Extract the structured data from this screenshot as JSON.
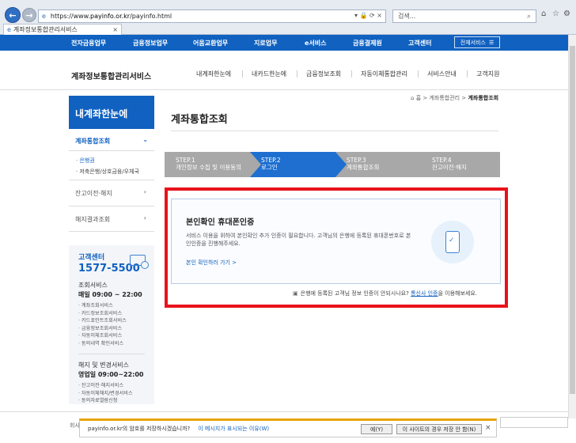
{
  "browser": {
    "url_secure": "https://www.",
    "url_domain": "payinfo.or.kr",
    "url_path": "/payinfo.html",
    "search_placeholder": "검색...",
    "tab_title": "계좌정보통합관리서비스",
    "tab_close": "×"
  },
  "gnb": {
    "items": [
      "전자금융업무",
      "금융정보업무",
      "어음교환업무",
      "지로업무",
      "e서비스",
      "금융결제원",
      "고객센터"
    ],
    "all_services": "전체서비스"
  },
  "header": {
    "logo": "계좌정보통합관리서비스",
    "nav": [
      "내계좌한눈에",
      "내카드한눈에",
      "금융정보조회",
      "자동이체통합관리",
      "서비스안내",
      "고객지원"
    ]
  },
  "breadcrumb": {
    "home": "홈",
    "mid": "계좌통합관리",
    "current": "계좌통합조회"
  },
  "sidebar": {
    "title": "내계좌한눈에",
    "active": "계좌통합조회",
    "sub1": "· 은행권",
    "sub2": "· 저축은행/상호금융/우체국",
    "menu1": "잔고이전·해지",
    "menu2": "해지결과조회"
  },
  "contact": {
    "title": "고객센터",
    "number": "1577-5500",
    "lookup_label": "조회서비스",
    "lookup_hours": "매일 09:00 ~ 22:00",
    "lookup_items": [
      "· 계좌조회서비스",
      "· 카드정보조회서비스",
      "· 카드포인트조회서비스",
      "· 금융정보조회서비스",
      "· 자동이체조회서비스",
      "· 동의내역 확인서비스"
    ],
    "change_label": "해지 및 변경서비스",
    "change_hours": "영업일 09:00~22:00",
    "change_items": [
      "· 잔고이전·해지서비스",
      "· 자동이체해지/변경서비스",
      "· 동의자료열람신청"
    ]
  },
  "main": {
    "title": "계좌통합조회",
    "steps": [
      {
        "no": "STEP.1",
        "label": "개인정보 수집 및 이용동의"
      },
      {
        "no": "STEP.2",
        "label": "로그인"
      },
      {
        "no": "STEP.3",
        "label": "계좌통합조회"
      },
      {
        "no": "STEP.4",
        "label": "잔고이전·해지"
      }
    ],
    "active_step": 2,
    "card_title": "본인확인 휴대폰인증",
    "card_desc": "서비스 이용을 위하여 본인확인 추가 인증이 필요합니다. 고객님의 은행에 등록된 휴대폰번호로 본인인증을 진행해주세요.",
    "card_link": "본인 확인하러 가기 >",
    "help_text": "은행에 등록된 고객님 정보 인증이 안되시나요?",
    "help_link": "통신사 인증",
    "help_tail": "을 이용해보세요."
  },
  "footer": {
    "partial": "회사"
  },
  "notification": {
    "question": "payinfo.or.kr의 암호를 저장하시겠습니까?",
    "why": "이 메시지가 표시되는 이유(W)",
    "yes": "예(Y)",
    "never": "이 사이트의 경우 저장 안 함(N)",
    "close": "×"
  },
  "colors": {
    "brand_blue": "#1061c0",
    "step_active": "#1f6fd0",
    "step_inactive": "#a8a8a8",
    "highlight_red": "#e8121a"
  }
}
